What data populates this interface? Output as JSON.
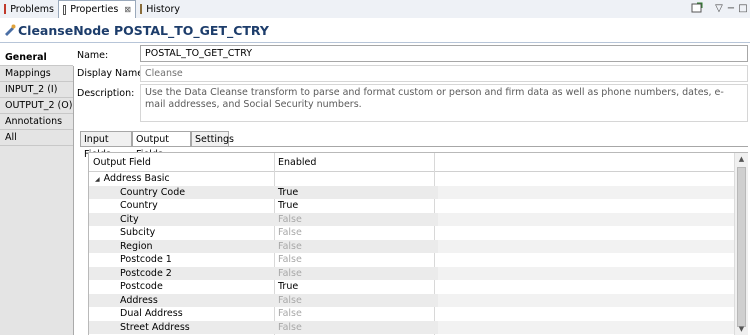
{
  "view_tabs": [
    {
      "label": "Problems",
      "icon": "problems-icon"
    },
    {
      "label": "Properties",
      "icon": "properties-icon",
      "close": "⊠"
    },
    {
      "label": "History",
      "icon": "history-icon"
    }
  ],
  "title": "CleanseNode POSTAL_TO_GET_CTRY",
  "categories": [
    "General",
    "Mappings",
    "INPUT_2 (I)",
    "OUTPUT_2 (O)",
    "Annotations",
    "All"
  ],
  "form": {
    "name_label": "Name:",
    "name_value": "POSTAL_TO_GET_CTRY",
    "display_label": "Display Name:",
    "display_value": "Cleanse",
    "desc_label": "Description:",
    "desc_value": "Use the Data Cleanse transform to parse and format custom or person and firm data as well as phone numbers, dates, e-mail addresses, and Social Security numbers."
  },
  "sub_tabs": [
    "Input Fields",
    "Output Fields",
    "Settings"
  ],
  "table": {
    "col_field": "Output Field",
    "col_enabled": "Enabled",
    "group": {
      "expander": "◢",
      "label": "Address Basic"
    },
    "rows": [
      {
        "field": "Country Code",
        "enabled": "True"
      },
      {
        "field": "Country",
        "enabled": "True"
      },
      {
        "field": "City",
        "enabled": "False"
      },
      {
        "field": "Subcity",
        "enabled": "False"
      },
      {
        "field": "Region",
        "enabled": "False"
      },
      {
        "field": "Postcode 1",
        "enabled": "False"
      },
      {
        "field": "Postcode 2",
        "enabled": "False"
      },
      {
        "field": "Postcode",
        "enabled": "True"
      },
      {
        "field": "Address",
        "enabled": "False"
      },
      {
        "field": "Dual Address",
        "enabled": "False"
      },
      {
        "field": "Street Address",
        "enabled": "False"
      }
    ]
  },
  "colors": {
    "accent": "#1d3d6b",
    "disabled_text": "#a8a8a8"
  }
}
